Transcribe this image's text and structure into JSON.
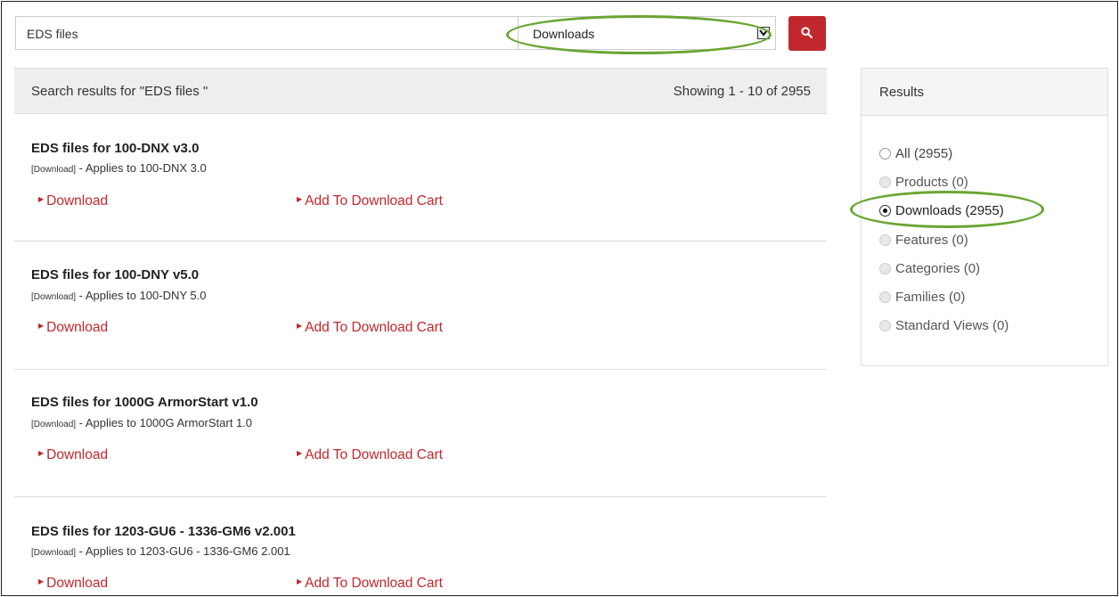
{
  "search": {
    "query": "EDS files",
    "type_selected": "Downloads"
  },
  "results_header": {
    "title": "Search results for \"EDS files \"",
    "count": "Showing 1 - 10 of 2955"
  },
  "results": [
    {
      "title": "EDS files for 100-DNX v3.0",
      "tag": "[Download]",
      "applies": " - Applies to 100-DNX 3.0",
      "download_label": "Download",
      "cart_label": "Add To Download Cart"
    },
    {
      "title": "EDS files for 100-DNY v5.0",
      "tag": "[Download]",
      "applies": " - Applies to 100-DNY 5.0",
      "download_label": "Download",
      "cart_label": "Add To Download Cart"
    },
    {
      "title": "EDS files for 1000G ArmorStart v1.0",
      "tag": "[Download]",
      "applies": " - Applies to 1000G ArmorStart 1.0",
      "download_label": "Download",
      "cart_label": "Add To Download Cart"
    },
    {
      "title": "EDS files for 1203-GU6 - 1336-GM6 v2.001",
      "tag": "[Download]",
      "applies": " - Applies to 1203-GU6 - 1336-GM6 2.001",
      "download_label": "Download",
      "cart_label": "Add To Download Cart"
    }
  ],
  "filters": {
    "title": "Results",
    "items": [
      {
        "label": "All (2955)",
        "state": "enabled"
      },
      {
        "label": "Products (0)",
        "state": "disabled"
      },
      {
        "label": "Downloads (2955)",
        "state": "checked"
      },
      {
        "label": "Features (0)",
        "state": "disabled"
      },
      {
        "label": "Categories (0)",
        "state": "disabled"
      },
      {
        "label": "Families (0)",
        "state": "disabled"
      },
      {
        "label": "Standard Views (0)",
        "state": "disabled"
      }
    ]
  },
  "colors": {
    "accent_red": "#c0282d",
    "highlight_green": "#6aa532"
  }
}
